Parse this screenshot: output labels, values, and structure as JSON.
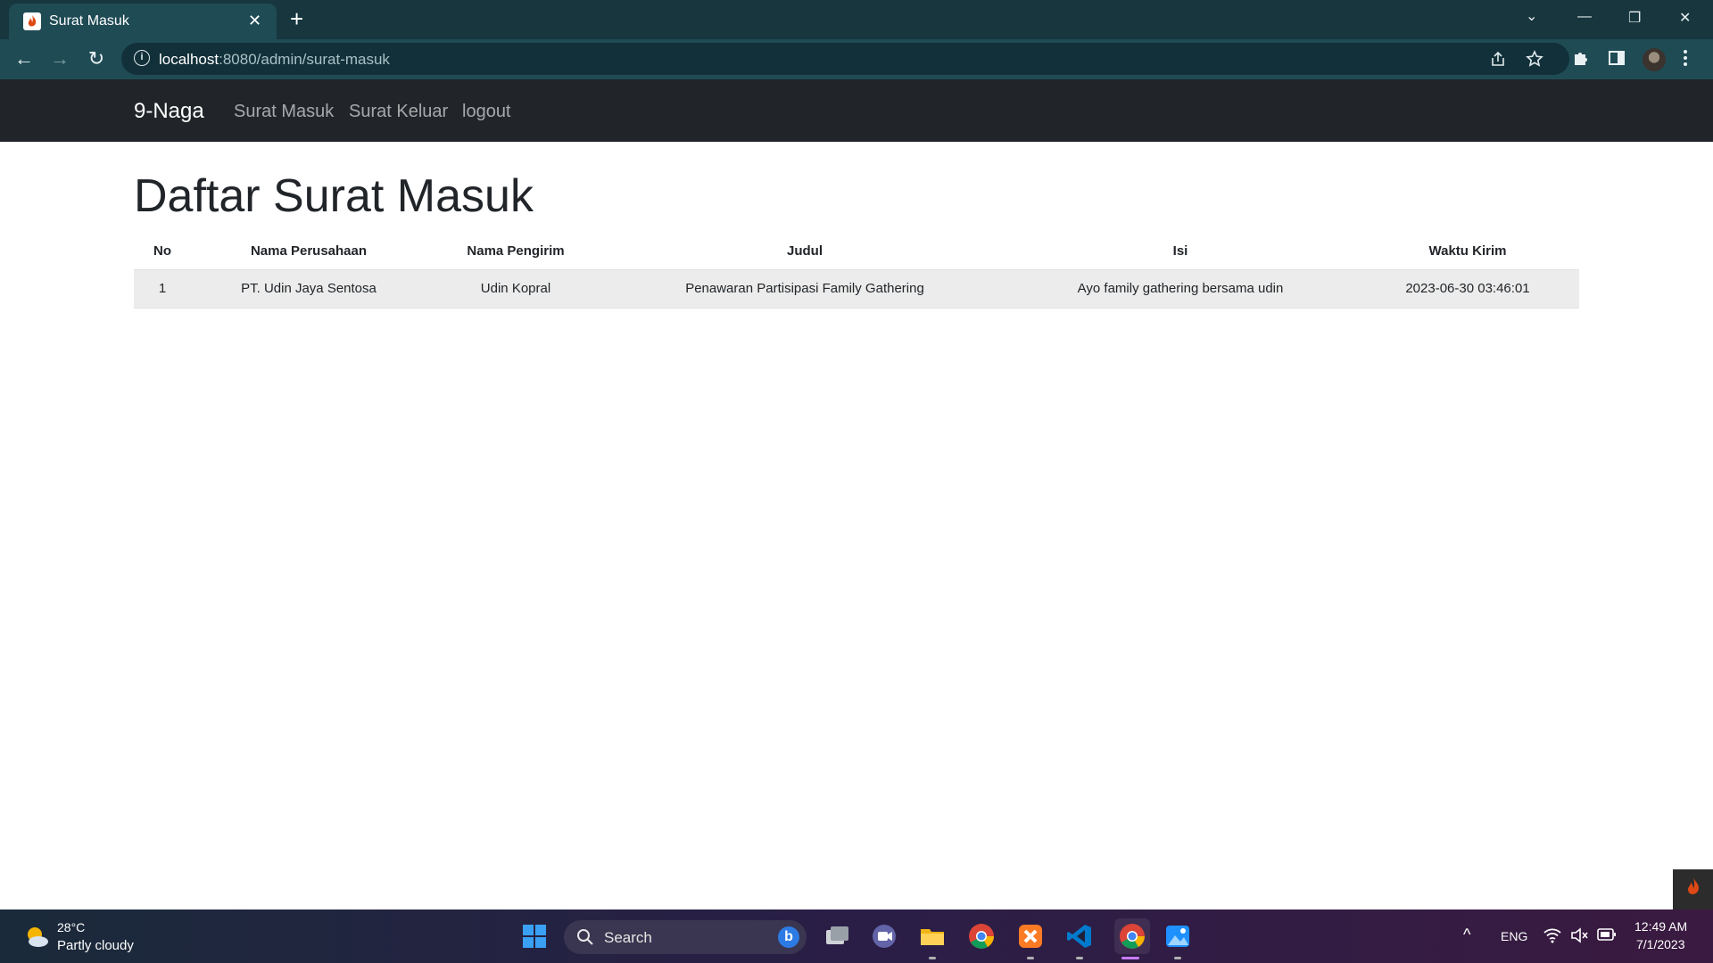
{
  "browser": {
    "tab_title": "Surat Masuk",
    "tab_close": "✕",
    "new_tab": "+",
    "url_host": "localhost",
    "url_rest": ":8080/admin/surat-masuk",
    "back": "←",
    "forward": "→",
    "reload": "↻",
    "window_controls": {
      "tab_search": "⌄",
      "minimize": "—",
      "restore": "❐",
      "close": "✕"
    }
  },
  "navbar": {
    "brand": "9-Naga",
    "links": [
      "Surat Masuk",
      "Surat Keluar",
      "logout"
    ]
  },
  "page": {
    "title": "Daftar Surat Masuk",
    "table": {
      "headers": [
        "No",
        "Nama Perusahaan",
        "Nama Pengirim",
        "Judul",
        "Isi",
        "Waktu Kirim"
      ],
      "rows": [
        [
          "1",
          "PT. Udin Jaya Sentosa",
          "Udin Kopral",
          "Penawaran Partisipasi Family Gathering",
          "Ayo family gathering bersama udin",
          "2023-06-30 03:46:01"
        ]
      ]
    }
  },
  "taskbar": {
    "weather_temp": "28°C",
    "weather_desc": "Partly cloudy",
    "search_placeholder": "Search",
    "tray_lang": "ENG",
    "tray_chevron": "^",
    "time": "12:49 AM",
    "date": "7/1/2023"
  },
  "colors": {
    "navbar_bg": "#212529",
    "table_row_bg": "#ececec",
    "browser_frame": "#17363d",
    "browser_toolbar": "#1f4b55"
  },
  "icons": {
    "tab_favicon": "codeigniter-flame-icon",
    "info": "info-icon",
    "share": "share-icon",
    "bookmark": "star-icon",
    "extensions": "puzzle-icon",
    "side_panel": "side-panel-icon",
    "menu": "kebab-menu-icon"
  }
}
